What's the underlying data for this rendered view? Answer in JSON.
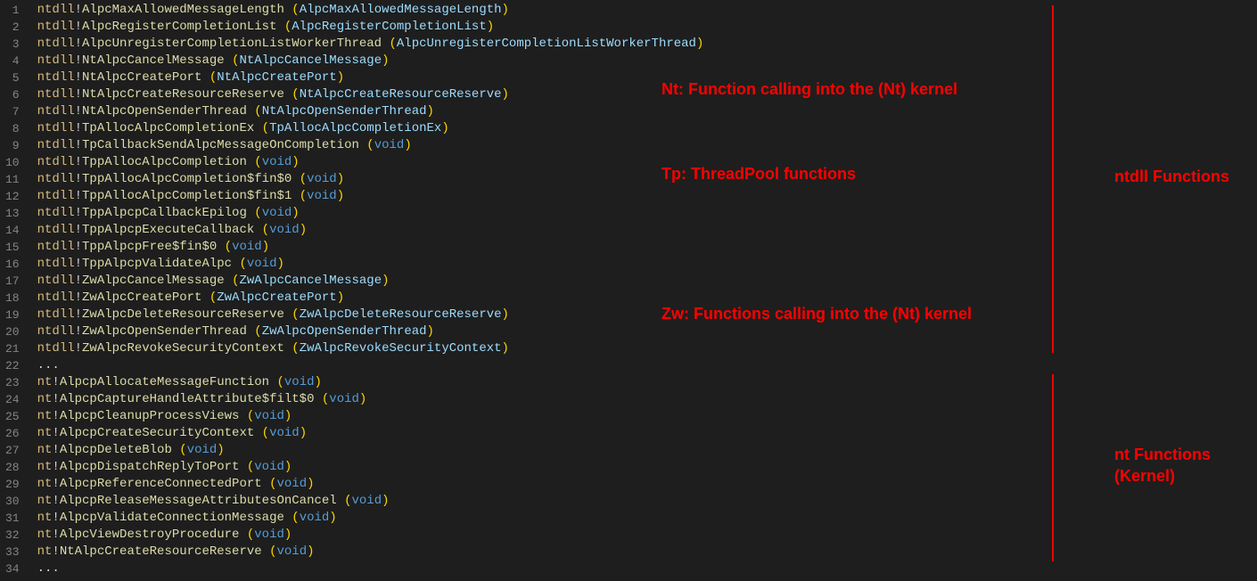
{
  "lines": [
    {
      "n": 1,
      "mod": "ntdll",
      "fn": "AlpcMaxAllowedMessageLength",
      "arg": "AlpcMaxAllowedMessageLength",
      "argIsVoid": false
    },
    {
      "n": 2,
      "mod": "ntdll",
      "fn": "AlpcRegisterCompletionList",
      "arg": "AlpcRegisterCompletionList",
      "argIsVoid": false
    },
    {
      "n": 3,
      "mod": "ntdll",
      "fn": "AlpcUnregisterCompletionListWorkerThread",
      "arg": "AlpcUnregisterCompletionListWorkerThread",
      "argIsVoid": false
    },
    {
      "n": 4,
      "mod": "ntdll",
      "fn": "NtAlpcCancelMessage",
      "arg": "NtAlpcCancelMessage",
      "argIsVoid": false
    },
    {
      "n": 5,
      "mod": "ntdll",
      "fn": "NtAlpcCreatePort",
      "arg": "NtAlpcCreatePort",
      "argIsVoid": false
    },
    {
      "n": 6,
      "mod": "ntdll",
      "fn": "NtAlpcCreateResourceReserve",
      "arg": "NtAlpcCreateResourceReserve",
      "argIsVoid": false
    },
    {
      "n": 7,
      "mod": "ntdll",
      "fn": "NtAlpcOpenSenderThread",
      "arg": "NtAlpcOpenSenderThread",
      "argIsVoid": false
    },
    {
      "n": 8,
      "mod": "ntdll",
      "fn": "TpAllocAlpcCompletionEx",
      "arg": "TpAllocAlpcCompletionEx",
      "argIsVoid": false
    },
    {
      "n": 9,
      "mod": "ntdll",
      "fn": "TpCallbackSendAlpcMessageOnCompletion",
      "arg": "void",
      "argIsVoid": true
    },
    {
      "n": 10,
      "mod": "ntdll",
      "fn": "TppAllocAlpcCompletion",
      "arg": "void",
      "argIsVoid": true
    },
    {
      "n": 11,
      "mod": "ntdll",
      "fn": "TppAllocAlpcCompletion$fin$0",
      "arg": "void",
      "argIsVoid": true
    },
    {
      "n": 12,
      "mod": "ntdll",
      "fn": "TppAllocAlpcCompletion$fin$1",
      "arg": "void",
      "argIsVoid": true
    },
    {
      "n": 13,
      "mod": "ntdll",
      "fn": "TppAlpcpCallbackEpilog",
      "arg": "void",
      "argIsVoid": true
    },
    {
      "n": 14,
      "mod": "ntdll",
      "fn": "TppAlpcpExecuteCallback",
      "arg": "void",
      "argIsVoid": true
    },
    {
      "n": 15,
      "mod": "ntdll",
      "fn": "TppAlpcpFree$fin$0",
      "arg": "void",
      "argIsVoid": true
    },
    {
      "n": 16,
      "mod": "ntdll",
      "fn": "TppAlpcpValidateAlpc",
      "arg": "void",
      "argIsVoid": true
    },
    {
      "n": 17,
      "mod": "ntdll",
      "fn": "ZwAlpcCancelMessage",
      "arg": "ZwAlpcCancelMessage",
      "argIsVoid": false
    },
    {
      "n": 18,
      "mod": "ntdll",
      "fn": "ZwAlpcCreatePort",
      "arg": "ZwAlpcCreatePort",
      "argIsVoid": false
    },
    {
      "n": 19,
      "mod": "ntdll",
      "fn": "ZwAlpcDeleteResourceReserve",
      "arg": "ZwAlpcDeleteResourceReserve",
      "argIsVoid": false
    },
    {
      "n": 20,
      "mod": "ntdll",
      "fn": "ZwAlpcOpenSenderThread",
      "arg": "ZwAlpcOpenSenderThread",
      "argIsVoid": false
    },
    {
      "n": 21,
      "mod": "ntdll",
      "fn": "ZwAlpcRevokeSecurityContext",
      "arg": "ZwAlpcRevokeSecurityContext",
      "argIsVoid": false
    },
    {
      "n": 22,
      "dots": "..."
    },
    {
      "n": 23,
      "mod": "nt",
      "fn": "AlpcpAllocateMessageFunction",
      "arg": "void",
      "argIsVoid": true
    },
    {
      "n": 24,
      "mod": "nt",
      "fn": "AlpcpCaptureHandleAttribute$filt$0",
      "arg": "void",
      "argIsVoid": true
    },
    {
      "n": 25,
      "mod": "nt",
      "fn": "AlpcpCleanupProcessViews",
      "arg": "void",
      "argIsVoid": true
    },
    {
      "n": 26,
      "mod": "nt",
      "fn": "AlpcpCreateSecurityContext",
      "arg": "void",
      "argIsVoid": true
    },
    {
      "n": 27,
      "mod": "nt",
      "fn": "AlpcpDeleteBlob",
      "arg": "void",
      "argIsVoid": true
    },
    {
      "n": 28,
      "mod": "nt",
      "fn": "AlpcpDispatchReplyToPort",
      "arg": "void",
      "argIsVoid": true
    },
    {
      "n": 29,
      "mod": "nt",
      "fn": "AlpcpReferenceConnectedPort",
      "arg": "void",
      "argIsVoid": true
    },
    {
      "n": 30,
      "mod": "nt",
      "fn": "AlpcpReleaseMessageAttributesOnCancel",
      "arg": "void",
      "argIsVoid": true
    },
    {
      "n": 31,
      "mod": "nt",
      "fn": "AlpcpValidateConnectionMessage",
      "arg": "void",
      "argIsVoid": true
    },
    {
      "n": 32,
      "mod": "nt",
      "fn": "AlpcViewDestroyProcedure",
      "arg": "void",
      "argIsVoid": true
    },
    {
      "n": 33,
      "mod": "nt",
      "fn": "NtAlpcCreateResourceReserve",
      "arg": "void",
      "argIsVoid": true
    },
    {
      "n": 34,
      "dots": "..."
    }
  ],
  "annotations": {
    "nt_desc": "Nt: Function calling into the (Nt) kernel",
    "tp_desc": "Tp: ThreadPool functions",
    "zw_desc": "Zw: Functions calling into the (Nt) kernel",
    "ntdll_group": "ntdll Functions",
    "kernel_group1": "nt Functions",
    "kernel_group2": "(Kernel)"
  }
}
